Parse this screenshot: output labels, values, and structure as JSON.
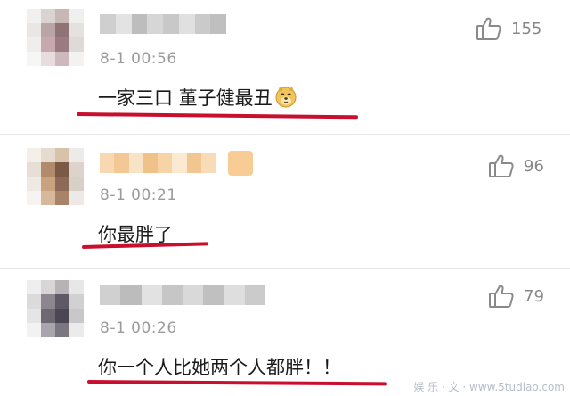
{
  "comments": [
    {
      "avatar_colors": [
        "#f1f0ee",
        "#d9d4d2",
        "#c7b7b5",
        "#efefee",
        "#e9e6e4",
        "#b9a4a6",
        "#8f7377",
        "#e4e1df",
        "#efeeed",
        "#c7a9ad",
        "#9b7a82",
        "#dedad8",
        "#f6f6f5",
        "#e7dde0",
        "#cdb8bd",
        "#f3f2f1"
      ],
      "name_colors": [
        "#cfcfcf",
        "#e3e3e3",
        "#bdbdbd",
        "#d6d6d6",
        "#c8c8c8",
        "#e0e0e0",
        "#cacaca",
        "#bfbfbf"
      ],
      "time": "8-1 00:56",
      "text": "一家三口 董子健最丑",
      "emoji": "doge-emoji",
      "like_count": "155"
    },
    {
      "avatar_colors": [
        "#f4efe9",
        "#e5dccf",
        "#d8c2aa",
        "#ecebea",
        "#e6dfd6",
        "#b28b6c",
        "#7a5a45",
        "#ddd3cc",
        "#efe9e3",
        "#c9a27f",
        "#8d6a55",
        "#d9cfc9",
        "#f6f3f0",
        "#d8b89a",
        "#a98368",
        "#ede9e6"
      ],
      "name_colors": [
        "#f7d8b0",
        "#f3c895",
        "#f9e3c7",
        "#f1c18a",
        "#f6d4a8",
        "#fbe9d2",
        "#f2c690",
        "#f8dcb8"
      ],
      "badge_color": "#f5c07a",
      "time": "8-1 00:21",
      "text": "你最胖了",
      "like_count": "96"
    },
    {
      "avatar_colors": [
        "#eeeeee",
        "#d7d5d6",
        "#b7b2b6",
        "#e8e7e8",
        "#dcdadc",
        "#8c8690",
        "#5f5966",
        "#d2d0d3",
        "#e6e5e6",
        "#6d6874",
        "#4b4653",
        "#c9c7ca",
        "#f2f2f2",
        "#a9a5ac",
        "#7b7680",
        "#ebebeb"
      ],
      "name_colors": [
        "#d0d0d0",
        "#bcbcbc",
        "#e2e2e2",
        "#c6c6c6",
        "#d9d9d9",
        "#c0c0c0",
        "#dedede",
        "#cbcbcb"
      ],
      "time": "8-1 00:26",
      "text": "你一个人比她两个人都胖！！",
      "like_count": "79"
    }
  ],
  "like_icon": "thumbs-up-icon",
  "underline_color": "#c8102e",
  "watermark": "娱 乐 · 文 · www.5tudiao.com"
}
